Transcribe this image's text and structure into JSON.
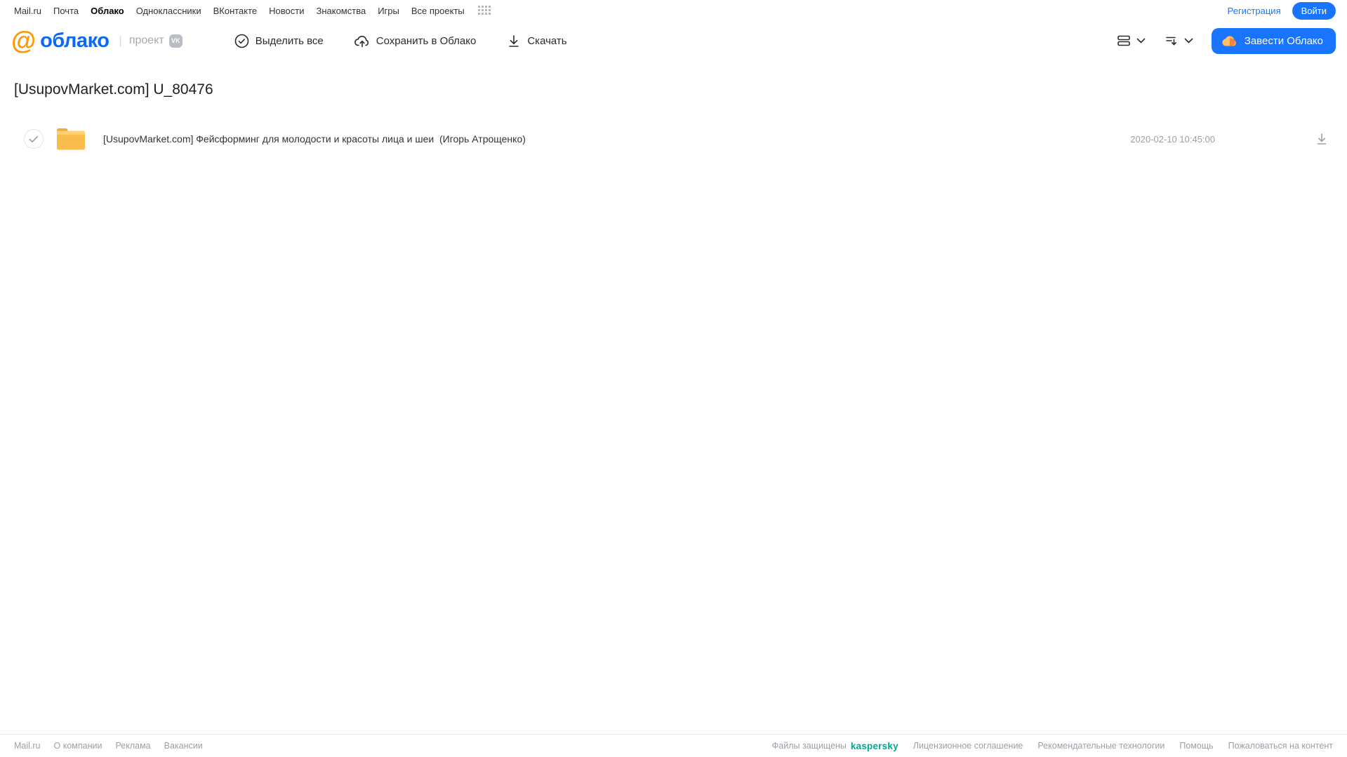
{
  "top_nav": {
    "links": [
      "Mail.ru",
      "Почта",
      "Облако",
      "Одноклассники",
      "ВКонтакте",
      "Новости",
      "Знакомства",
      "Игры",
      "Все проекты"
    ],
    "active_link": "Облако",
    "register_label": "Регистрация",
    "login_label": "Войти"
  },
  "toolbar": {
    "logo_at": "@",
    "logo_text": "облако",
    "project_label": "проект",
    "vk_badge": "VK",
    "select_all_label": "Выделить все",
    "save_to_cloud_label": "Сохранить в Облако",
    "download_label": "Скачать",
    "get_cloud_label": "Завести Облако"
  },
  "main": {
    "title": "[UsupovMarket.com] U_80476",
    "files": [
      {
        "type": "folder",
        "name": "[UsupovMarket.com] Фейсформинг для молодости и красоты лица и шеи  (Игорь Атрощенко)",
        "date": "2020-02-10 10:45:00"
      }
    ]
  },
  "footer": {
    "left_links": [
      "Mail.ru",
      "О компании",
      "Реклама",
      "Вакансии"
    ],
    "protected_label": "Файлы защищены",
    "kaspersky_label": "kaspersky",
    "right_links": [
      "Лицензионное соглашение",
      "Рекомендательные технологии",
      "Помощь",
      "Пожаловаться на контент"
    ]
  },
  "colors": {
    "accent_blue": "#1975ff",
    "logo_blue": "#0b69f5",
    "logo_orange": "#ff9800",
    "folder_yellow": "#fbbc4e",
    "kaspersky_green": "#00a88e",
    "muted_grey": "#9aa0a6"
  }
}
